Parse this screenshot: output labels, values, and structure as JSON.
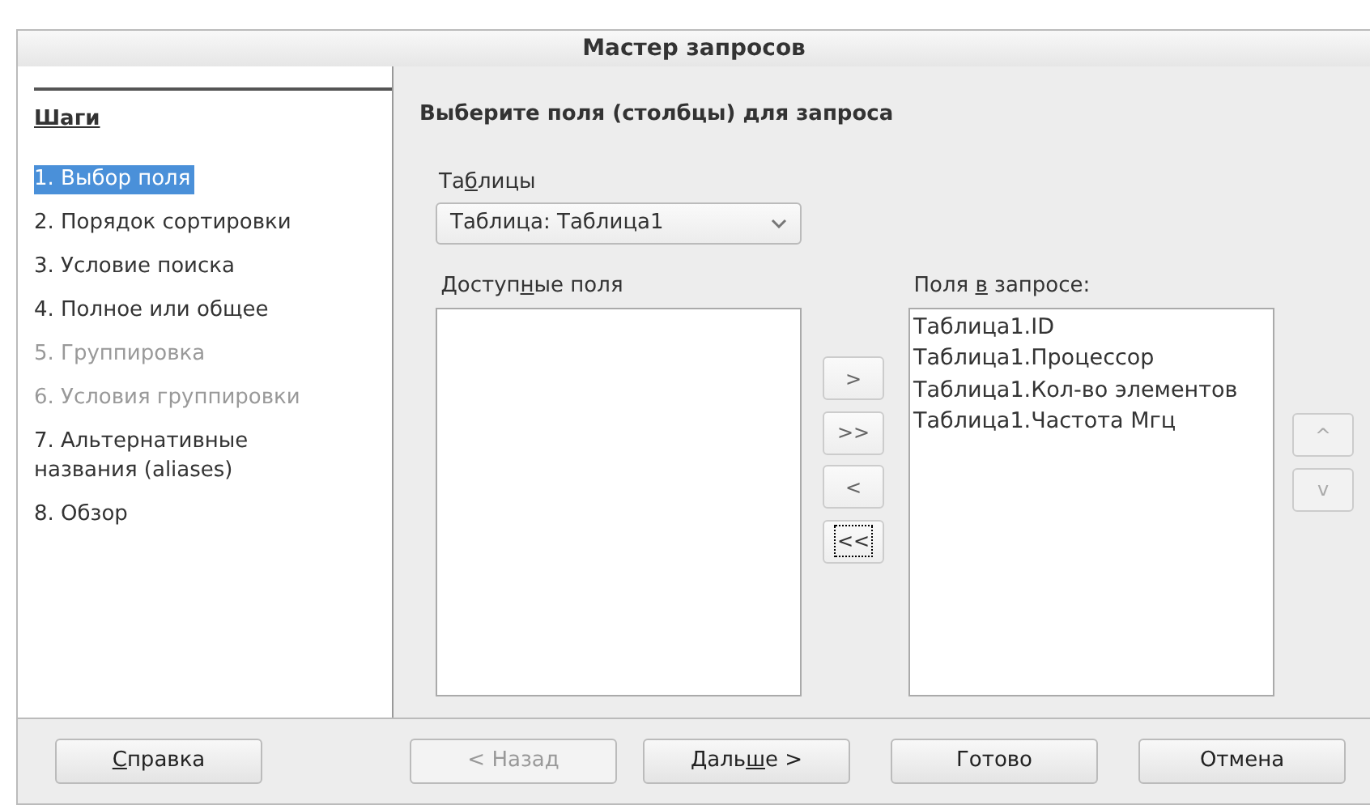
{
  "window": {
    "title": "Мастер запросов"
  },
  "sidebar": {
    "heading": "Шаги",
    "items": [
      {
        "label": "1. Выбор поля",
        "selected": true,
        "disabled": false
      },
      {
        "label": "2. Порядок сортировки",
        "selected": false,
        "disabled": false
      },
      {
        "label": "3. Условие поиска",
        "selected": false,
        "disabled": false
      },
      {
        "label": "4. Полное или общее",
        "selected": false,
        "disabled": false
      },
      {
        "label": "5. Группировка",
        "selected": false,
        "disabled": true
      },
      {
        "label": "6. Условия группировки",
        "selected": false,
        "disabled": true
      },
      {
        "label": "7. Альтернативные названия (aliases)",
        "selected": false,
        "disabled": false
      },
      {
        "label": "8. Обзор",
        "selected": false,
        "disabled": false
      }
    ]
  },
  "page": {
    "heading": "Выберите поля (столбцы) для запроса",
    "tables_label": {
      "pre": "Та",
      "key": "б",
      "post": "лицы"
    },
    "tables_value": "Таблица: Таблица1",
    "available_label": {
      "pre": "Доступ",
      "key": "н",
      "post": "ые поля"
    },
    "selected_label": {
      "pre": "Поля ",
      "key": "в",
      "post": " запросе:"
    },
    "selected_fields": [
      "Таблица1.ID",
      "Таблица1.Процессор",
      "Таблица1.Кол-во элементов",
      "Таблица1.Частота Мгц"
    ],
    "move_buttons": [
      {
        "label": ">",
        "disabled": false,
        "focused": false
      },
      {
        "label": ">>",
        "disabled": false,
        "focused": false
      },
      {
        "label": "<",
        "disabled": false,
        "focused": false
      },
      {
        "label": "<<",
        "disabled": false,
        "focused": true
      }
    ],
    "order_buttons": [
      {
        "label": "^",
        "disabled": true
      },
      {
        "label": "v",
        "disabled": true
      }
    ]
  },
  "buttons": [
    {
      "key": "С",
      "post": "правка",
      "disabled": false
    },
    {
      "pre": "< Назад",
      "disabled": true
    },
    {
      "pre": "Даль",
      "key": "ш",
      "post": "е >",
      "disabled": false
    },
    {
      "pre": "Готово",
      "disabled": false
    },
    {
      "pre": "Отмена",
      "disabled": false
    }
  ]
}
